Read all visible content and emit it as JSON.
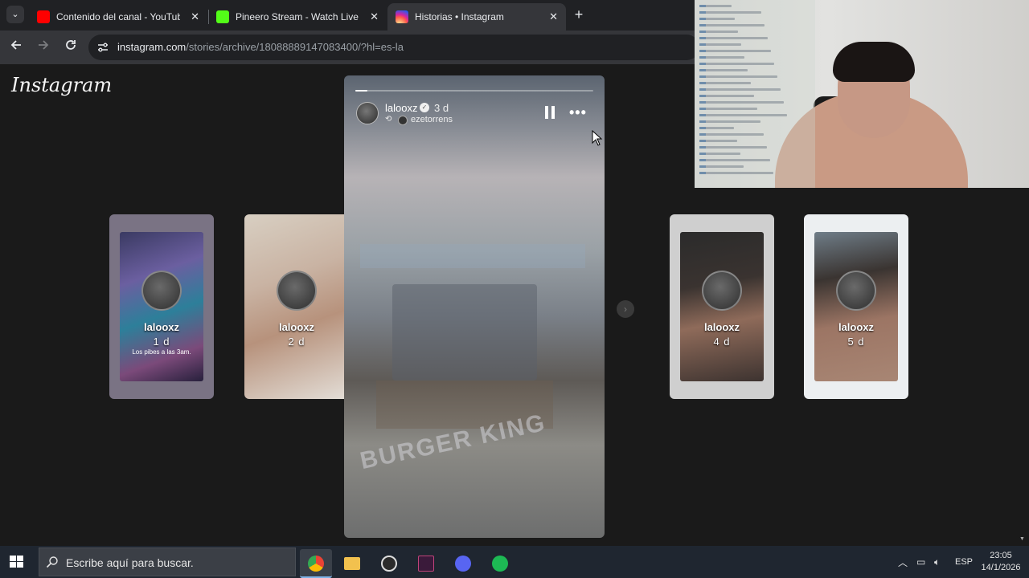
{
  "browser": {
    "tabs": [
      {
        "title": "Contenido del canal - YouTube",
        "favicon": "youtube-icon",
        "color": "#ff0000"
      },
      {
        "title": "Pineero Stream - Watch Live on",
        "favicon": "kick-icon",
        "color": "#53fc18"
      },
      {
        "title": "Historias • Instagram",
        "favicon": "instagram-icon",
        "color": "#d6249f",
        "active": true
      }
    ],
    "close_glyph": "✕",
    "new_tab_glyph": "+",
    "tab_menu_glyph": "⌄",
    "url_host": "instagram.com",
    "url_path": "/stories/archive/18088889147083400/?hl=es-la"
  },
  "instagram": {
    "logo": "Instagram",
    "main_story": {
      "username": "lalooxz",
      "time": "3 d",
      "repost_user": "ezetorrens",
      "progress": 0.05,
      "sign_text": "BURGER KING"
    },
    "side_stories": [
      {
        "username": "lalooxz",
        "age": "1 d",
        "caption": "Los pibes a las 3am."
      },
      {
        "username": "lalooxz",
        "age": "2 d",
        "caption": ""
      },
      {
        "username": "lalooxz",
        "age": "4 d",
        "caption": ""
      },
      {
        "username": "lalooxz",
        "age": "5 d",
        "caption": ""
      }
    ],
    "next_glyph": "›"
  },
  "taskbar": {
    "search_placeholder": "Escribe aquí para buscar.",
    "apps": [
      "chrome",
      "file-explorer",
      "obs",
      "vegas",
      "discord",
      "spotify"
    ],
    "language": "ESP",
    "time": "23:05",
    "date": "14/1/2026"
  }
}
